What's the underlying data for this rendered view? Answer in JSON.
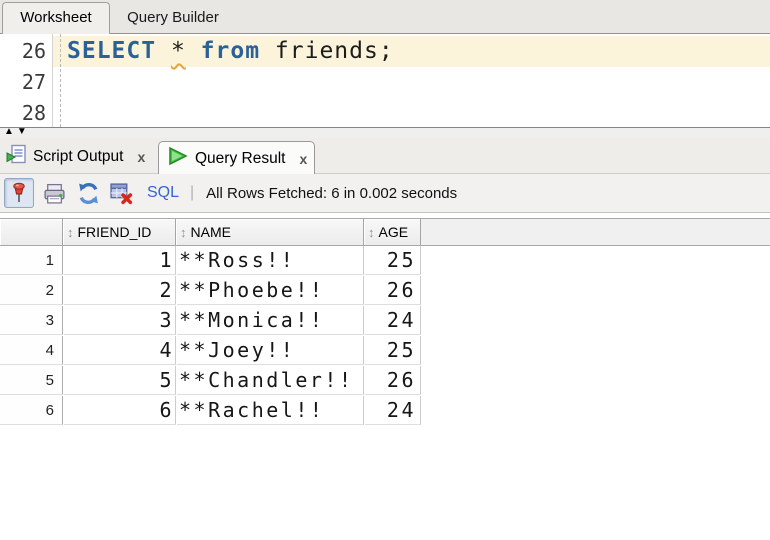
{
  "editor_tabs": {
    "items": [
      {
        "label": "Worksheet",
        "active": true
      },
      {
        "label": "Query Builder",
        "active": false
      }
    ]
  },
  "editor": {
    "line_numbers": [
      "26",
      "27",
      "28"
    ],
    "active_line_number": "26",
    "sql_tokens": [
      {
        "text": "SELECT",
        "type": "keyword"
      },
      {
        "text": " ",
        "type": "plain"
      },
      {
        "text": "*",
        "type": "error"
      },
      {
        "text": " ",
        "type": "plain"
      },
      {
        "text": "from",
        "type": "keyword"
      },
      {
        "text": " ",
        "type": "plain"
      },
      {
        "text": "friends;",
        "type": "plain"
      }
    ],
    "colors": {
      "keyword": "#2a6198",
      "plain": "#1c1c1c",
      "squiggle": "#e8a33b",
      "active_line_bg": "#fbf4db"
    }
  },
  "splitter": {
    "up_arrow": "▲",
    "down_arrow": "▼"
  },
  "result_tabs": {
    "items": [
      {
        "label": "Script Output",
        "icon": "script-output-icon",
        "close": "x",
        "active": false
      },
      {
        "label": "Query Result",
        "icon": "query-result-icon",
        "close": "x",
        "active": true
      }
    ]
  },
  "toolbar": {
    "icons": [
      "pin-icon",
      "printer-icon",
      "refresh-icon",
      "delete-grid-icon"
    ],
    "sql_label": "SQL",
    "separator": "|",
    "status": "All Rows Fetched: 6 in 0.002 seconds"
  },
  "grid": {
    "sort_icon": "↕",
    "columns": [
      {
        "label": "FRIEND_ID"
      },
      {
        "label": "NAME"
      },
      {
        "label": "AGE"
      }
    ],
    "rows": [
      {
        "num": "1",
        "friend_id": "1",
        "name": "**Ross!!",
        "age": "25"
      },
      {
        "num": "2",
        "friend_id": "2",
        "name": "**Phoebe!!",
        "age": "26"
      },
      {
        "num": "3",
        "friend_id": "3",
        "name": "**Monica!!",
        "age": "24"
      },
      {
        "num": "4",
        "friend_id": "4",
        "name": "**Joey!!",
        "age": "25"
      },
      {
        "num": "5",
        "friend_id": "5",
        "name": "**Chandler!!",
        "age": "26"
      },
      {
        "num": "6",
        "friend_id": "6",
        "name": "**Rachel!!",
        "age": "24"
      }
    ]
  }
}
